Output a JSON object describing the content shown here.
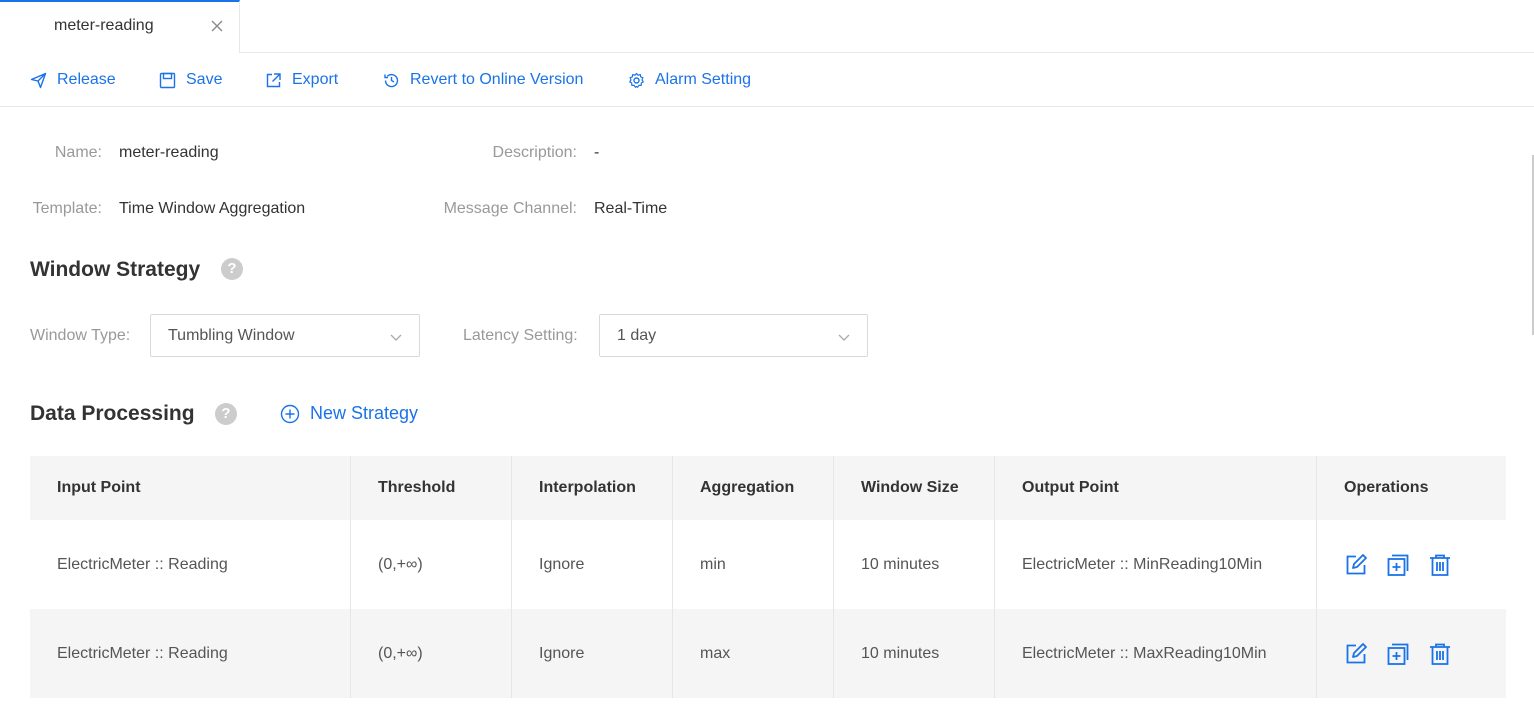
{
  "tab": {
    "label": "meter-reading"
  },
  "toolbar": {
    "release": "Release",
    "save": "Save",
    "export": "Export",
    "revert": "Revert to Online Version",
    "alarm": "Alarm Setting"
  },
  "info": {
    "name_label": "Name:",
    "name_value": "meter-reading",
    "description_label": "Description:",
    "description_value": "-",
    "template_label": "Template:",
    "template_value": "Time Window Aggregation",
    "channel_label": "Message Channel:",
    "channel_value": "Real-Time"
  },
  "window_strategy": {
    "title": "Window Strategy",
    "help": "?",
    "window_type_label": "Window Type:",
    "window_type_value": "Tumbling Window",
    "latency_label": "Latency Setting:",
    "latency_value": "1 day"
  },
  "data_processing": {
    "title": "Data Processing",
    "help": "?",
    "new_strategy": "New Strategy",
    "columns": [
      "Input Point",
      "Threshold",
      "Interpolation",
      "Aggregation",
      "Window Size",
      "Output Point",
      "Operations"
    ],
    "rows": [
      [
        "ElectricMeter :: Reading",
        "(0,+∞)",
        "Ignore",
        "min",
        "10 minutes",
        "ElectricMeter :: MinReading10Min"
      ],
      [
        "ElectricMeter :: Reading",
        "(0,+∞)",
        "Ignore",
        "max",
        "10 minutes",
        "ElectricMeter :: MaxReading10Min"
      ]
    ]
  },
  "colors": {
    "accent": "#1a73e8",
    "label": "#999999",
    "header_bg": "#f5f5f5"
  }
}
